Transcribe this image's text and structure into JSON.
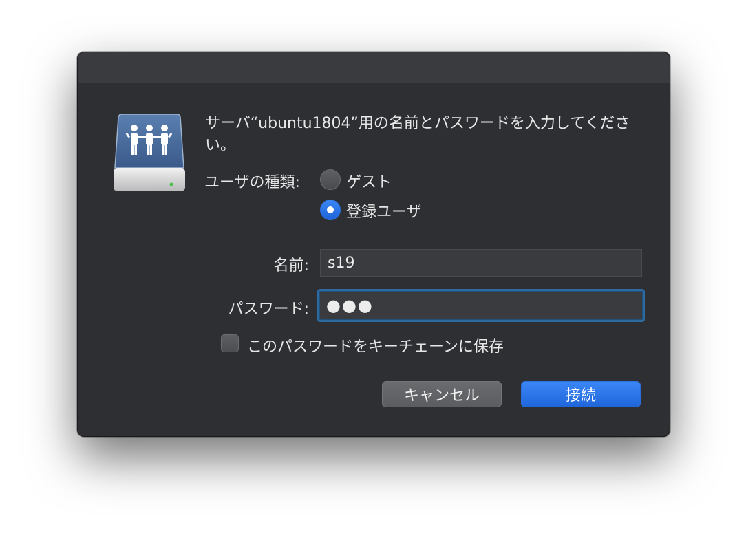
{
  "dialog": {
    "message": "サーバ“ubuntu1804”用の名前とパスワードを入力してください。",
    "icon": "server-share-icon"
  },
  "user_type": {
    "label": "ユーザの種類:",
    "options": [
      {
        "label": "ゲスト",
        "selected": false
      },
      {
        "label": "登録ユーザ",
        "selected": true
      }
    ]
  },
  "name_field": {
    "label": "名前:",
    "value": "s19"
  },
  "password_field": {
    "label": "パスワード:",
    "value": "●●●"
  },
  "keychain": {
    "label": "このパスワードをキーチェーンに保存",
    "checked": false
  },
  "buttons": {
    "cancel": "キャンセル",
    "connect": "接続"
  },
  "colors": {
    "accent": "#1f66db",
    "dialog_bg": "#2e2f32",
    "focus_ring": "#2d6a9f"
  }
}
